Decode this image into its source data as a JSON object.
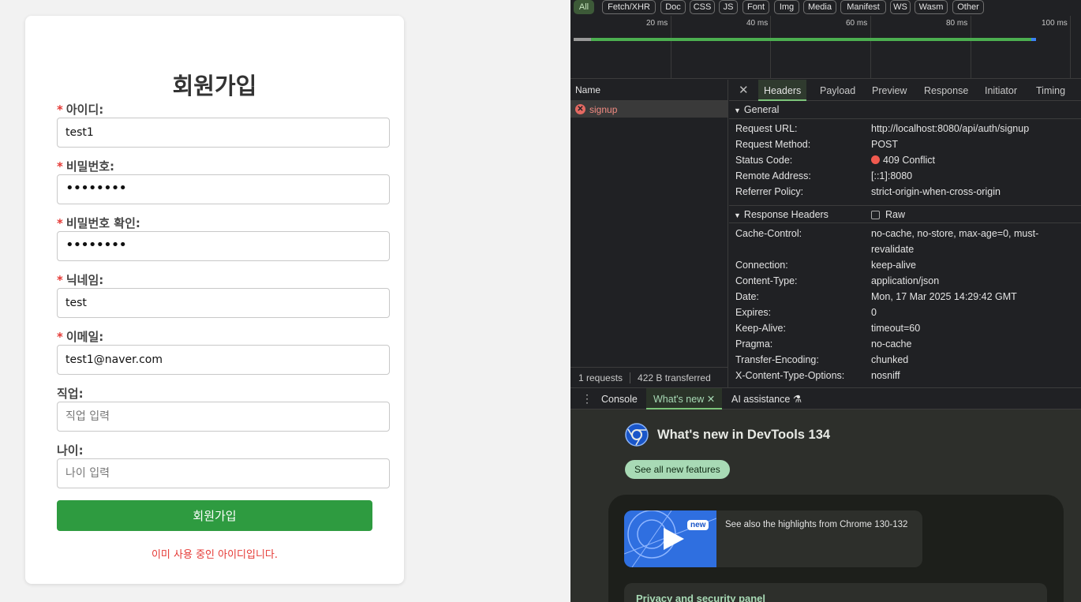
{
  "signup": {
    "title": "회원가입",
    "required_mark": "*",
    "fields": [
      {
        "label": "아이디:",
        "value": "test1",
        "placeholder": "",
        "required": true
      },
      {
        "label": "비밀번호:",
        "value": "••••••••",
        "placeholder": "",
        "required": true
      },
      {
        "label": "비밀번호 확인:",
        "value": "••••••••",
        "placeholder": "",
        "required": true
      },
      {
        "label": "닉네임:",
        "value": "test",
        "placeholder": "",
        "required": true
      },
      {
        "label": "이메일:",
        "value": "test1@naver.com",
        "placeholder": "",
        "required": true
      },
      {
        "label": "직업:",
        "value": "",
        "placeholder": "직업 입력",
        "required": false
      },
      {
        "label": "나이:",
        "value": "",
        "placeholder": "나이 입력",
        "required": false
      }
    ],
    "submit_label": "회원가입",
    "error_message": "이미 사용 중인 아이디입니다.",
    "colors": {
      "submit": "#2e9b40",
      "error": "#e53935"
    }
  },
  "devtools": {
    "filters": [
      "All",
      "Fetch/XHR",
      "Doc",
      "CSS",
      "JS",
      "Font",
      "Img",
      "Media",
      "Manifest",
      "WS",
      "Wasm",
      "Other"
    ],
    "active_filter": "All",
    "timeline_ticks": [
      "20 ms",
      "40 ms",
      "60 ms",
      "80 ms",
      "100 ms"
    ],
    "name_header": "Name",
    "requests": [
      {
        "name": "signup",
        "status": "error"
      }
    ],
    "footer": {
      "requests": "1 requests",
      "transferred": "422 B transferred"
    },
    "tabs": [
      "Headers",
      "Payload",
      "Preview",
      "Response",
      "Initiator",
      "Timing"
    ],
    "active_tab": "Headers",
    "general": {
      "title": "General",
      "rows": [
        {
          "k": "Request URL:",
          "v": "http://localhost:8080/api/auth/signup"
        },
        {
          "k": "Request Method:",
          "v": "POST"
        },
        {
          "k": "Status Code:",
          "v": "409 Conflict"
        },
        {
          "k": "Remote Address:",
          "v": "[::1]:8080"
        },
        {
          "k": "Referrer Policy:",
          "v": "strict-origin-when-cross-origin"
        }
      ]
    },
    "response_headers": {
      "title": "Response Headers",
      "raw_label": "Raw",
      "rows": [
        {
          "k": "Cache-Control:",
          "v": "no-cache, no-store, max-age=0, must-revalidate"
        },
        {
          "k": "Connection:",
          "v": "keep-alive"
        },
        {
          "k": "Content-Type:",
          "v": "application/json"
        },
        {
          "k": "Date:",
          "v": "Mon, 17 Mar 2025 14:29:42 GMT"
        },
        {
          "k": "Expires:",
          "v": "0"
        },
        {
          "k": "Keep-Alive:",
          "v": "timeout=60"
        },
        {
          "k": "Pragma:",
          "v": "no-cache"
        },
        {
          "k": "Transfer-Encoding:",
          "v": "chunked"
        },
        {
          "k": "X-Content-Type-Options:",
          "v": "nosniff"
        }
      ]
    },
    "drawer": {
      "tabs": [
        "Console",
        "What's new",
        "AI assistance"
      ],
      "active_tab": "What's new",
      "whats_new_title": "What's new in DevTools 134",
      "see_all_label": "See all new features",
      "promo_badge": "new",
      "promo_text": "See also the highlights from Chrome 130-132",
      "privacy_title": "Privacy and security panel"
    }
  }
}
